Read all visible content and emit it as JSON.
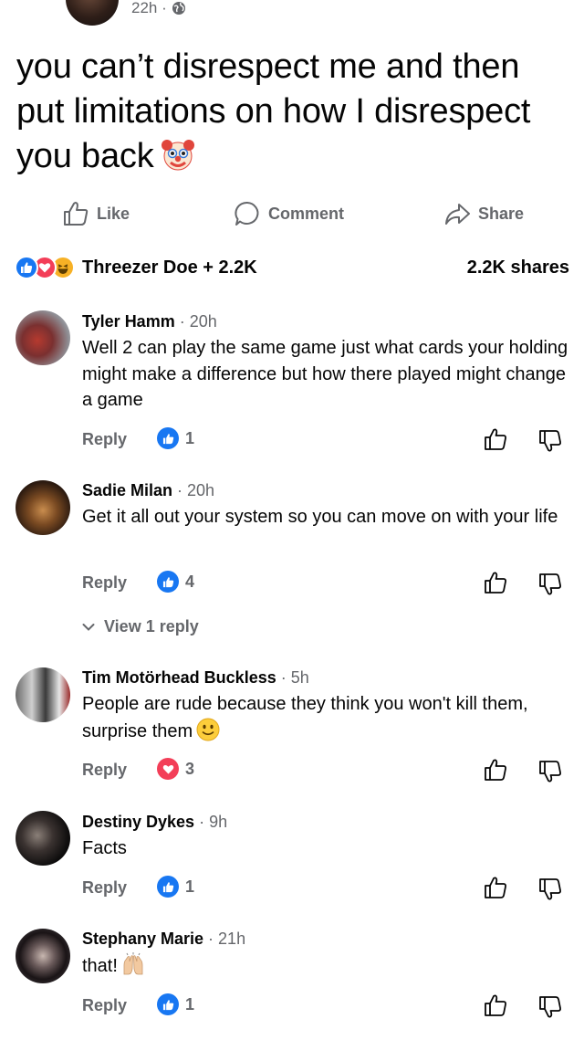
{
  "post": {
    "time": "22h ·",
    "text": "you can’t disrespect me and then put limitations on how I disrespect you back",
    "emoji": "clown-face"
  },
  "actions": {
    "like": "Like",
    "comment": "Comment",
    "share": "Share"
  },
  "reactions": {
    "summary": "Threezer Doe + 2.2K",
    "shares": "2.2K shares",
    "types": [
      "like",
      "love",
      "haha"
    ]
  },
  "comments": [
    {
      "name": "Tyler Hamm",
      "time": " · 20h",
      "text": "Well 2 can play the same game just what cards your holding might make a difference but how there played might change a game",
      "reply": "Reply",
      "reaction": "like",
      "count": "1"
    },
    {
      "name": "Sadie Milan",
      "time": " · 20h",
      "text": "Get it all out your system so you can move on with your life",
      "reply": "Reply",
      "reaction": "like",
      "count": "4",
      "view_replies": "View 1 reply"
    },
    {
      "name": "Tim Motörhead Buckless",
      "time": " · 5h",
      "text": "People are rude because they think you won't kill them, surprise them",
      "emoji": "slightly-smiling-face",
      "reply": "Reply",
      "reaction": "love",
      "count": "3"
    },
    {
      "name": "Destiny Dykes",
      "time": " · 9h",
      "text": "Facts",
      "reply": "Reply",
      "reaction": "like",
      "count": "1"
    },
    {
      "name": "Stephany Marie",
      "time": " · 21h",
      "text": "that!",
      "emoji": "raising-hands",
      "reply": "Reply",
      "reaction": "like",
      "count": "1"
    }
  ],
  "colors": {
    "like_blue": "#1877f2",
    "love_red": "#f33e58",
    "haha_yellow": "#f7b125",
    "secondary_text": "#65676b"
  }
}
